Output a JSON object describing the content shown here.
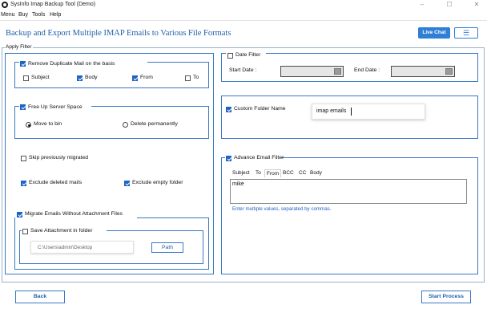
{
  "window": {
    "title": "SysInfo Imap Backup Tool (Demo)",
    "minimize": "–",
    "maximize": "☐",
    "close": "✕"
  },
  "menu": [
    "Menu",
    "Buy",
    "Tools",
    "Help"
  ],
  "header": {
    "title": "Backup and Export Multiple IMAP Emails to Various File Formats",
    "live_chat": "Live Chat",
    "menu_icon": "☰"
  },
  "apply_filter": {
    "legend": "Apply Filter",
    "remove_duplicate": {
      "label": "Remove Duplicate Mail on the basis",
      "checked": true,
      "options": [
        {
          "label": "Subject",
          "checked": false
        },
        {
          "label": "Body",
          "checked": true
        },
        {
          "label": "From",
          "checked": true
        },
        {
          "label": "To",
          "checked": false
        }
      ]
    },
    "free_up": {
      "label": "Free Up Server Space",
      "checked": true,
      "move_to_bin": "Move to bin",
      "delete_permanently": "Delete permanently",
      "selected": "move_to_bin"
    },
    "skip_migrated": {
      "label": "Skip previously migrated",
      "checked": false
    },
    "exclude_deleted": {
      "label": "Exclude deleted mails",
      "checked": true
    },
    "exclude_empty": {
      "label": "Exclude empty folder",
      "checked": true
    },
    "migrate_without_attachment": {
      "label": "Migrate Emails Without Attachment Files",
      "checked": true
    },
    "save_attachment": {
      "label": "Save Attachment in folder",
      "checked": false,
      "path_value": "C:\\Users\\admin\\Desktop",
      "path_button": "Path"
    }
  },
  "date_filter": {
    "label": "Date Filter",
    "checked": false,
    "start_label": "Start Date :",
    "end_label": "End Date :"
  },
  "custom_folder": {
    "label": "Custom Folder Name",
    "checked": true,
    "value": "imap emails"
  },
  "advance_filter": {
    "label": "Advance Email Filter",
    "checked": true,
    "tabs": [
      "Subject",
      "To",
      "From",
      "BCC",
      "CC",
      "Body"
    ],
    "active_tab": "From",
    "value": "mike",
    "hint": "Enter multiple values, separated by commas."
  },
  "footer": {
    "back": "Back",
    "start": "Start Process"
  },
  "colors": {
    "accent": "#2f7fd6",
    "heading": "#1f5fa8",
    "hint": "#1f63c4"
  }
}
